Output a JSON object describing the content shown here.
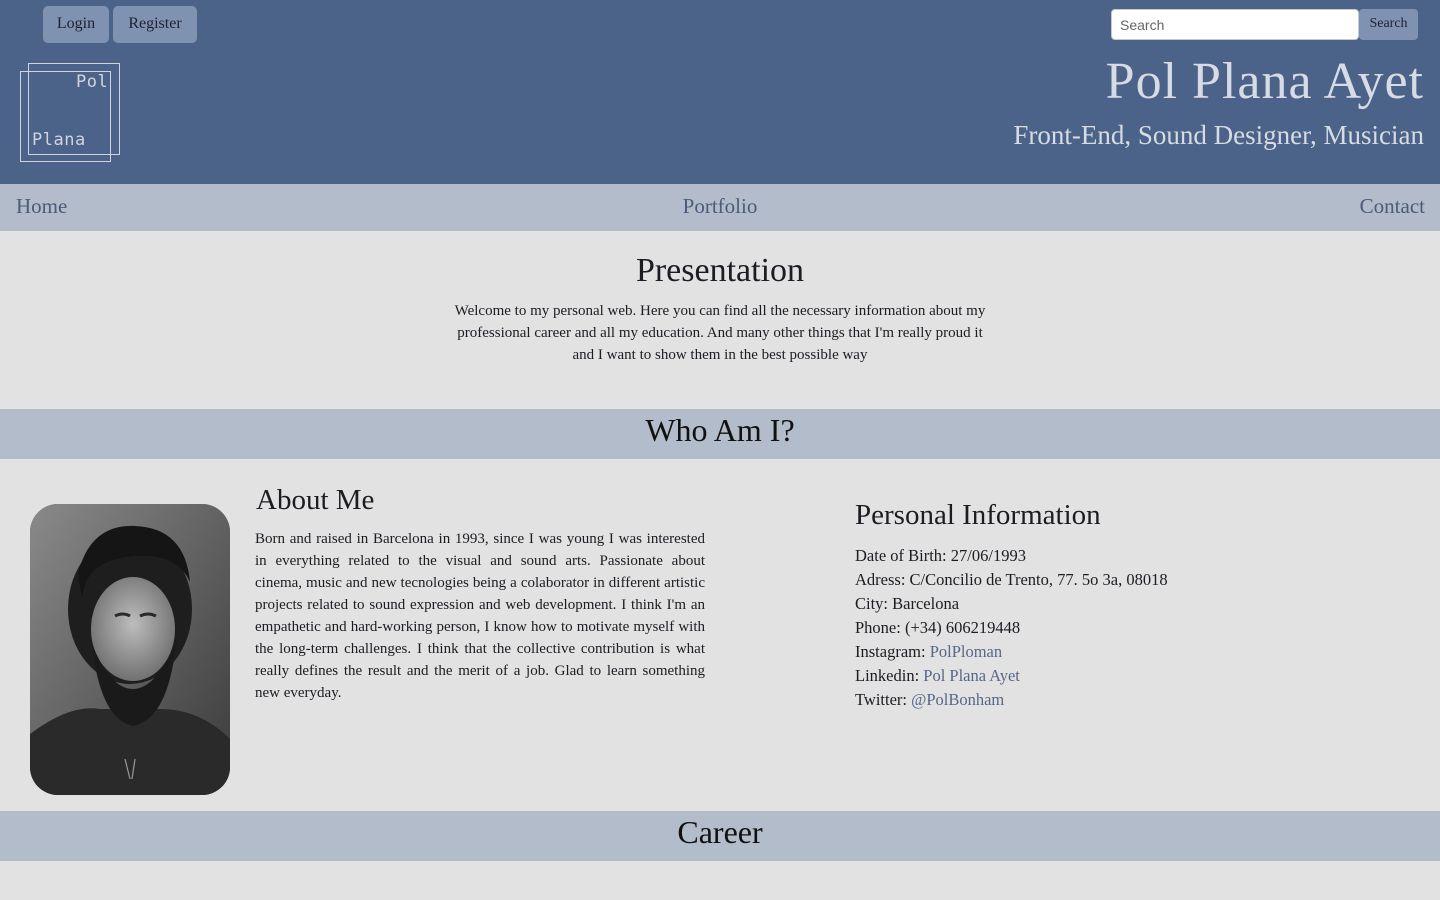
{
  "header": {
    "login_label": "Login",
    "register_label": "Register",
    "search_placeholder": "Search",
    "search_button_label": "Search",
    "logo_line1": "Pol",
    "logo_line2": "Plana",
    "title": "Pol Plana Ayet",
    "subtitle": "Front-End, Sound Designer, Musician"
  },
  "nav": {
    "home": "Home",
    "portfolio": "Portfolio",
    "contact": "Contact"
  },
  "presentation": {
    "title": "Presentation",
    "text": "Welcome to my personal web. Here you can find all the necessary information about my professional career and all my education. And many other things that I'm really proud it and I want to show them in the best possible way"
  },
  "who": {
    "title": "Who Am I?",
    "about_title": "About Me",
    "about_text": "Born and raised in Barcelona in 1993, since I was young I was interested in everything related to the visual and sound arts. Passionate about cinema, music and new tecnologies being a colaborator in different artistic projects related to sound expression and web development. I think I'm an empathetic and hard-working person, I know how to motivate myself with the long-term challenges. I think that the collective contribution is what really defines the result and the merit of a job. Glad to learn something new everyday."
  },
  "personal": {
    "title": "Personal Information",
    "birth_label": "Date of Birth: ",
    "birth_value": "27/06/1993",
    "address_label": "Adress: ",
    "address_value": "C/Concilio de Trento, 77. 5o 3a, 08018",
    "city_label": "City: ",
    "city_value": "Barcelona",
    "phone_label": "Phone: ",
    "phone_value": "(+34) 606219448",
    "instagram_label": "Instagram: ",
    "instagram_link": "PolPloman",
    "linkedin_label": "Linkedin: ",
    "linkedin_link": "Pol Plana Ayet",
    "twitter_label": "Twitter: ",
    "twitter_link": "@PolBonham"
  },
  "career": {
    "title": "Career"
  },
  "colors": {
    "header_bg": "#4b6389",
    "nav_bg": "#b2bccb",
    "page_bg": "#e2e2e3",
    "link": "#56678a"
  }
}
